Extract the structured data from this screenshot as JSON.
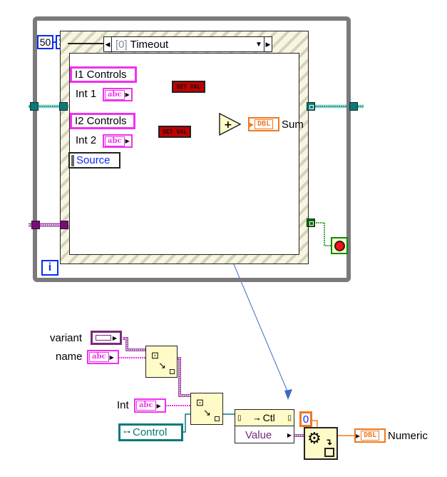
{
  "while_loop": {
    "iteration_label": "i"
  },
  "timeout_constant": "50",
  "timer_icon": "hourglass-icon",
  "event_structure": {
    "case_index": "[0]",
    "case_name": "Timeout"
  },
  "controls": {
    "i1_controls": "I1 Controls",
    "int1_label": "Int 1",
    "int1_type": "abc",
    "i2_controls": "I2 Controls",
    "int2_label": "Int 2",
    "int2_type": "abc",
    "source": "Source"
  },
  "get_val_1": "GET VAL",
  "get_val_2": "GET VAL",
  "add_symbol": "+",
  "sum_indicator": {
    "type": "DBL",
    "label": "Sum"
  },
  "stop_button_icon": "stop-icon",
  "lower_diagram": {
    "variant_label": "variant",
    "name_label": "name",
    "name_type": "abc",
    "int_label": "Int",
    "int_type": "abc",
    "control_label": "Control",
    "property_node": {
      "header": "Ctl",
      "property": "Value"
    },
    "default_constant": "0",
    "numeric_indicator": {
      "type": "DBL",
      "label": "Numeric"
    }
  },
  "colors": {
    "loop_border": "#7a7a7a",
    "string_wire": "#f030f0",
    "variant_wire": "#7a0a7a",
    "numeric_wire": "#f07820",
    "refnum_wire": "#0a7a78",
    "boolean_wire": "#0a8a0a",
    "annotation_arrow": "#3a6ac8",
    "getval_bg": "#c00000"
  }
}
